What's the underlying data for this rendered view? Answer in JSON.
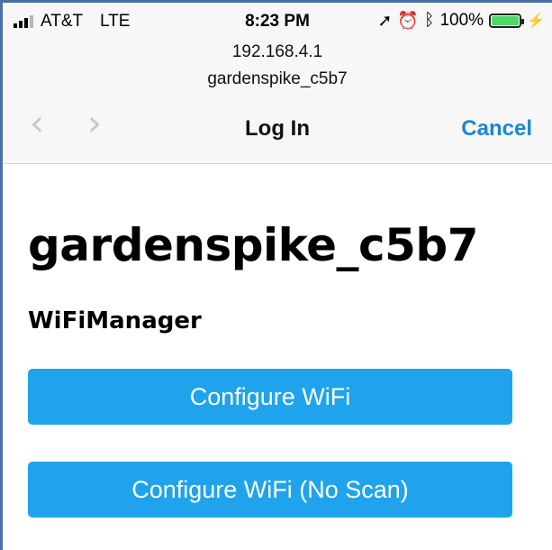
{
  "status_bar": {
    "carrier": "AT&T",
    "network": "LTE",
    "time": "8:23 PM",
    "battery": "100%",
    "icons": [
      "signal-icon",
      "location-arrow-icon",
      "alarm-icon",
      "bluetooth-icon",
      "battery-icon",
      "charging-bolt-icon"
    ]
  },
  "address": {
    "host": "192.168.4.1",
    "page_name": "gardenspike_c5b7"
  },
  "nav": {
    "title": "Log In",
    "cancel_label": "Cancel",
    "back_icon": "chevron-left-icon",
    "forward_icon": "chevron-right-icon"
  },
  "content": {
    "heading": "gardenspike_c5b7",
    "subheading": "WiFiManager",
    "buttons": [
      {
        "label": "Configure WiFi"
      },
      {
        "label": "Configure WiFi (No Scan)"
      }
    ]
  },
  "colors": {
    "button_bg": "#1fa3ec",
    "link": "#1a86d6",
    "battery_fill": "#4cd964",
    "frame_border": "#4a6fa5"
  }
}
